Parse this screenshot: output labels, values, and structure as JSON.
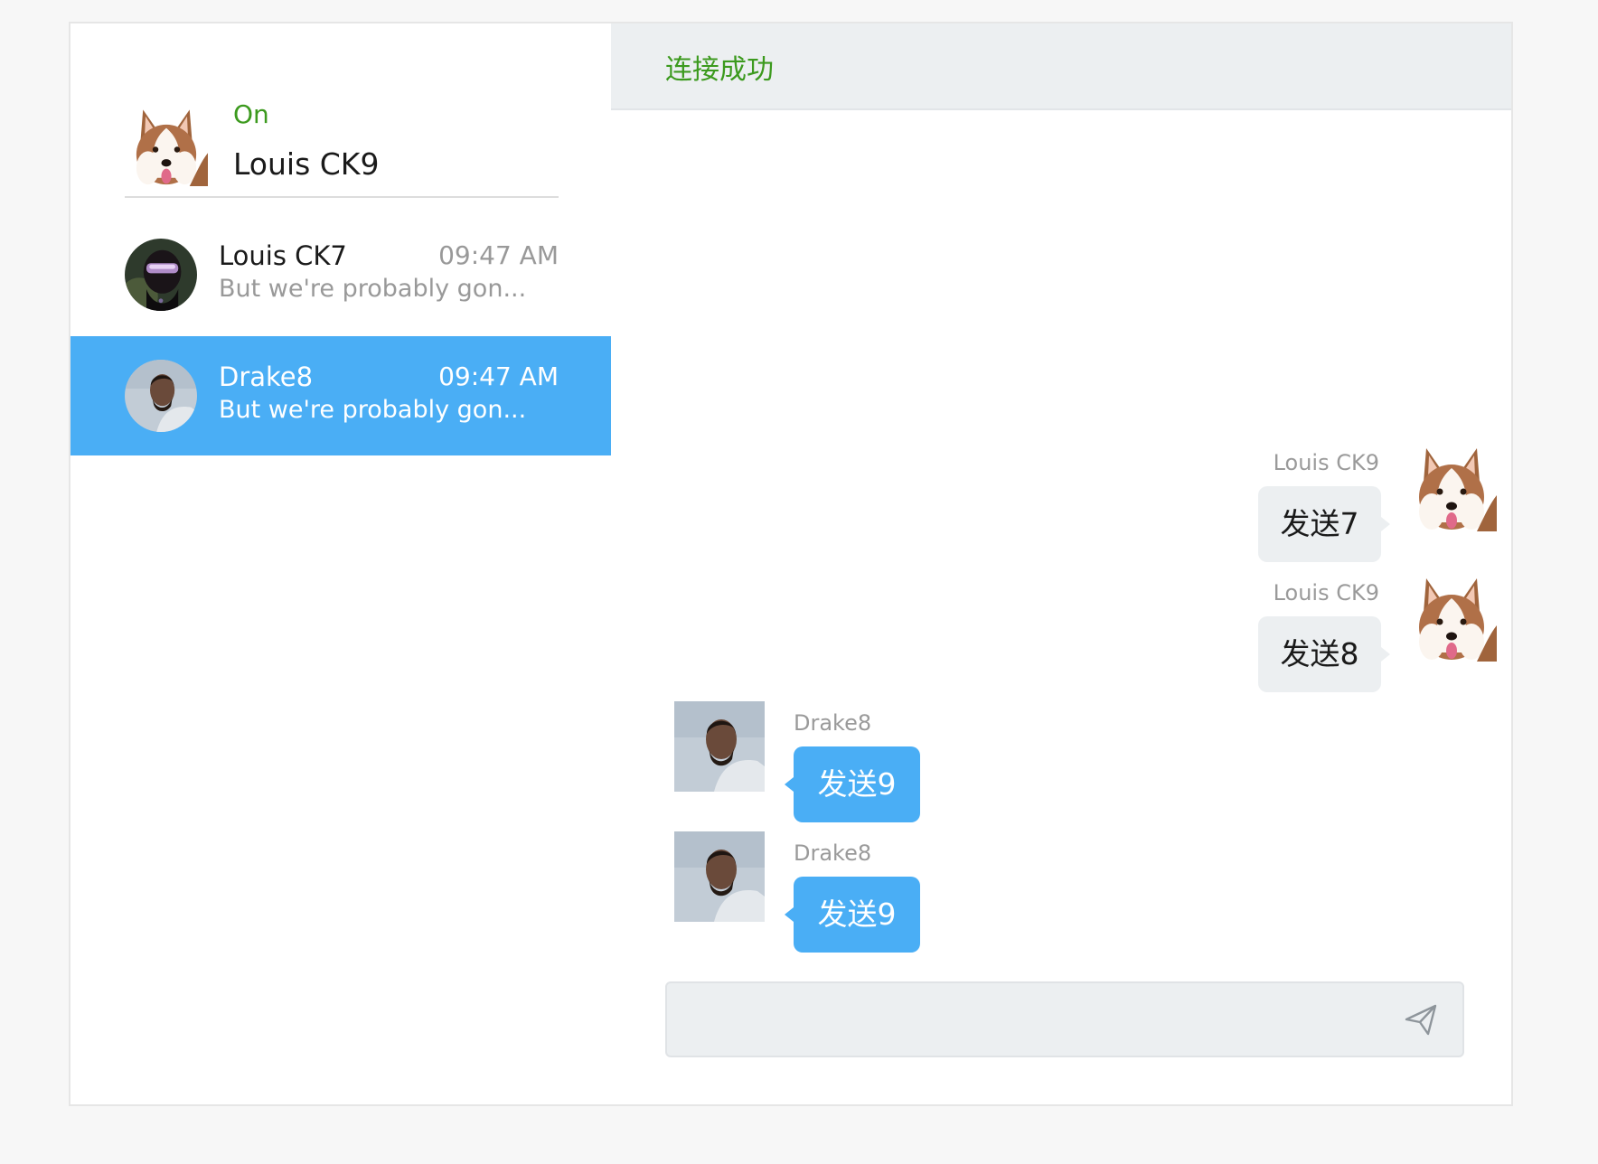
{
  "me": {
    "status": "On",
    "name": "Louis CK9",
    "avatar_icon": "husky-avatar"
  },
  "conversations": [
    {
      "name": "Louis CK7",
      "time": "09:47 AM",
      "preview": "But we're probably gon...",
      "avatar_icon": "helmet-avatar",
      "active": false
    },
    {
      "name": "Drake8",
      "time": "09:47 AM",
      "preview": "But we're probably gon...",
      "avatar_icon": "drake-avatar",
      "active": true
    }
  ],
  "chat": {
    "header_title": "连接成功",
    "messages": [
      {
        "sender": "Louis CK9",
        "text": "发送7",
        "direction": "outgoing",
        "avatar_icon": "husky-avatar"
      },
      {
        "sender": "Louis CK9",
        "text": "发送8",
        "direction": "outgoing",
        "avatar_icon": "husky-avatar"
      },
      {
        "sender": "Drake8",
        "text": "发送9",
        "direction": "incoming",
        "avatar_icon": "drake-avatar"
      },
      {
        "sender": "Drake8",
        "text": "发送9",
        "direction": "incoming",
        "avatar_icon": "drake-avatar"
      }
    ],
    "input": {
      "value": "",
      "placeholder": "",
      "send_icon": "send-icon"
    }
  },
  "colors": {
    "accent": "#4aaef5",
    "status_green": "#3c9a1e",
    "panel_gray": "#eceff1",
    "page_bg": "#f7f7f7"
  }
}
